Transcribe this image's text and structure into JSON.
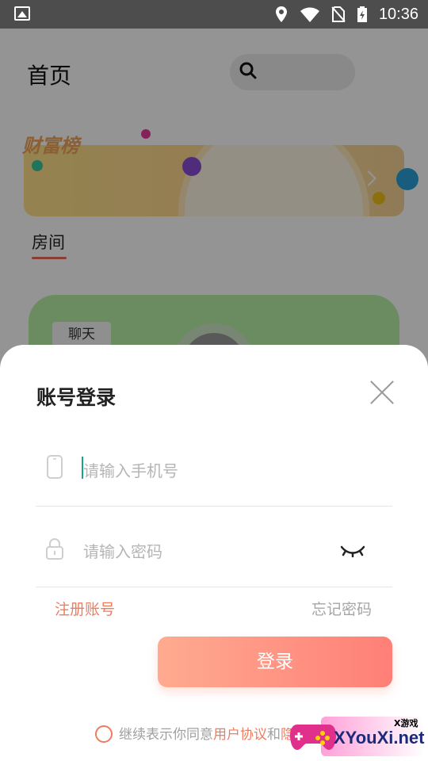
{
  "status_bar": {
    "time": "10:36",
    "icons": [
      "image-icon",
      "location-icon",
      "wifi-icon",
      "no-sim-icon",
      "battery-charging-icon"
    ]
  },
  "background_page": {
    "title": "首页",
    "banner_title": "财富榜",
    "section_label": "房间",
    "card_tag": "聊天"
  },
  "login_sheet": {
    "title": "账号登录",
    "phone_placeholder": "请输入手机号",
    "password_placeholder": "请输入密码",
    "register_link": "注册账号",
    "forgot_link": "忘记密码",
    "login_button": "登录",
    "agreement_prefix": "继续表示你同意",
    "agreement_user": "用户协议",
    "agreement_and": "和",
    "agreement_privacy_partial": "隐"
  },
  "watermark": {
    "text": "XYouXi.net",
    "small_text": "X游戏"
  },
  "colors": {
    "accent": "#f07b5d",
    "button_start": "#ffab90",
    "button_end": "#ff7f77",
    "caret": "#19a48a"
  }
}
